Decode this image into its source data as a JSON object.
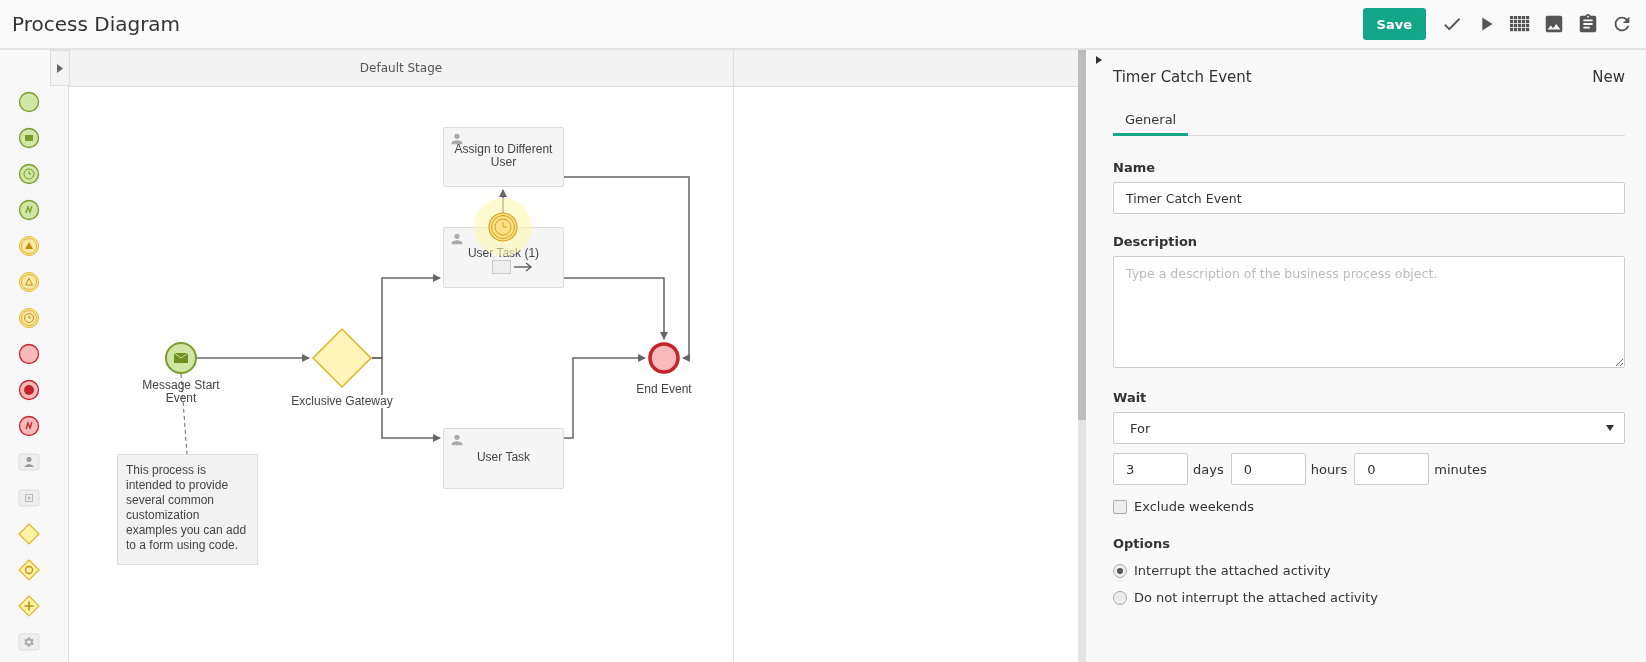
{
  "header": {
    "title": "Process Diagram",
    "save_button": "Save"
  },
  "stage": {
    "title": "Default Stage"
  },
  "diagram": {
    "nodes": [
      {
        "kind": "task",
        "label": "Assign to Different User",
        "selected": false
      },
      {
        "kind": "task",
        "label": "User Task (1)",
        "selected": false
      },
      {
        "kind": "task",
        "label": "User Task",
        "selected": false
      },
      {
        "kind": "message-start",
        "label": "Message Start Event",
        "selected": false
      },
      {
        "kind": "gateway",
        "label": "Exclusive Gateway",
        "selected": false
      },
      {
        "kind": "end",
        "label": "End Event",
        "selected": false
      },
      {
        "kind": "timer",
        "selected": true
      },
      {
        "kind": "annotation",
        "label": "This process is intended to provide several common customization examples you can add to a form using code.",
        "selected": false
      }
    ]
  },
  "properties": {
    "title": "Timer Catch Event",
    "status": "New",
    "tabs": [
      {
        "label": "General",
        "selected": true
      }
    ],
    "name": {
      "label": "Name",
      "value": "Timer Catch Event"
    },
    "description": {
      "label": "Description",
      "placeholder": "Type a description of the business process object."
    },
    "wait": {
      "label": "Wait",
      "value": "For"
    },
    "duration": [
      {
        "value": "3",
        "unit": "days"
      },
      {
        "value": "0",
        "unit": "hours"
      },
      {
        "value": "0",
        "unit": "minutes"
      }
    ],
    "exclude_weekends": {
      "label": "Exclude weekends",
      "checked": false
    },
    "options": {
      "label": "Options",
      "choices": [
        {
          "label": "Interrupt the attached activity",
          "selected": true
        },
        {
          "label": "Do not interrupt the attached activity",
          "selected": false
        }
      ]
    }
  }
}
